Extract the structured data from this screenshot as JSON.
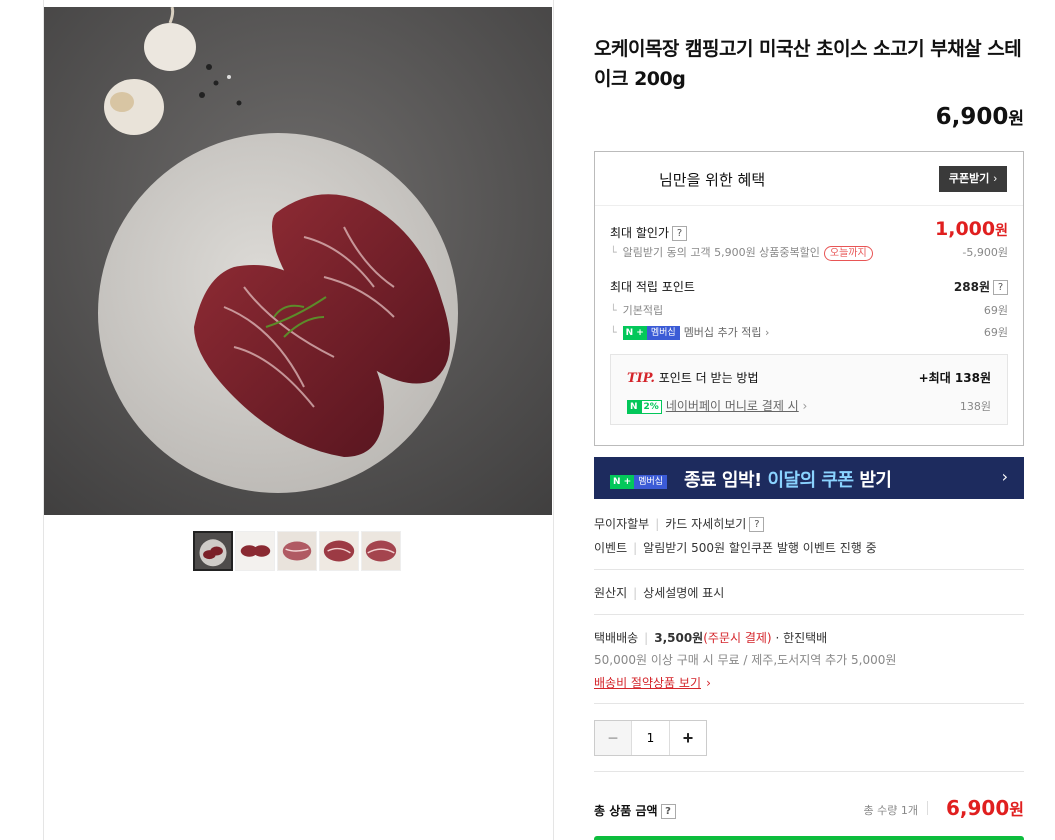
{
  "product": {
    "title": "오케이목장 캠핑고기 미국산 초이스 소고기 부채살 스테이크 200g",
    "price": "6,900",
    "price_unit": "원"
  },
  "benefit": {
    "header": "님만을 위한 혜택",
    "coupon_button": "쿠폰받기",
    "max_discount_label": "최대 할인가",
    "max_discount_value": "1,000",
    "max_discount_unit": "원",
    "alert_discount_text": "알림받기 동의 고객 5,900원 상품중복할인",
    "today_badge": "오늘까지",
    "alert_discount_value": "-5,900원",
    "max_point_label": "최대 적립 포인트",
    "max_point_value": "288원",
    "basic_point_label": "기본적립",
    "basic_point_value": "69원",
    "npay_tag": "N +",
    "membership_tag": "멤버십",
    "membership_label": "멤버십 추가 적립",
    "membership_value": "69원",
    "tip_label": "TIP.",
    "tip_text": "포인트 더 받는 방법",
    "tip_max": "+최대 138원",
    "npay_pct_n": "N",
    "npay_pct": "2%",
    "npay_money_label": "네이버페이 머니로 결제 시",
    "npay_money_value": "138원"
  },
  "banner": {
    "n_plus": "N +",
    "membership": "멤버십",
    "text_main": "종료 임박! ",
    "text_accent": "이달의 쿠폰",
    "text_end": " 받기"
  },
  "info": {
    "installment": "무이자할부",
    "card_detail": "카드 자세히보기",
    "event_label": "이벤트",
    "event_text": "알림받기 500원 할인쿠폰 발행 이벤트 진행 중",
    "origin_label": "원산지",
    "origin_text": "상세설명에 표시",
    "shipping_label": "택배배송",
    "shipping_price": "3,500원",
    "shipping_note": "(주문시 결제)",
    "courier": "· 한진택배",
    "shipping_free": "50,000원 이상 구매 시 무료 / 제주,도서지역 추가 5,000원",
    "shipping_saving_link": "배송비 절약상품 보기"
  },
  "quantity": {
    "minus": "−",
    "value": "1",
    "plus": "+"
  },
  "total": {
    "label": "총 상품 금액",
    "count": "총 수량 1개",
    "price": "6,900",
    "unit": "원"
  },
  "colors": {
    "accent_red": "#e01f1f",
    "banner_bg": "#1d2b5e",
    "naver_green": "#03c75a"
  }
}
